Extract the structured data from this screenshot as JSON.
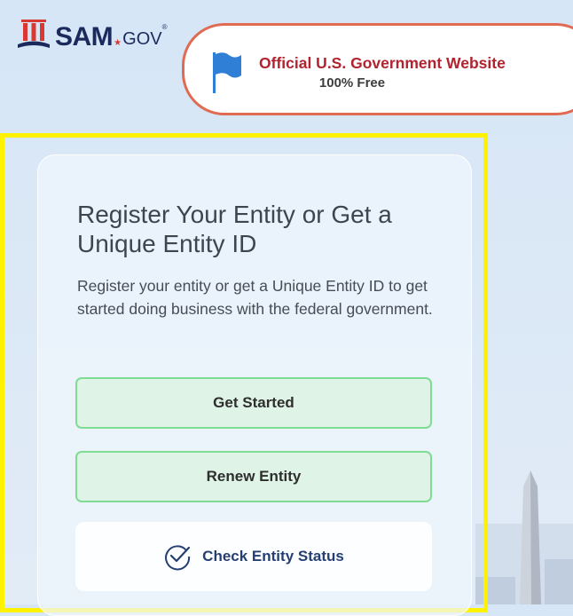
{
  "header": {
    "logo": {
      "name": "SAM",
      "suffix": "GOV",
      "reg": "®"
    },
    "official_banner": {
      "line1": "Official U.S. Government Website",
      "line2": "100% Free"
    }
  },
  "card": {
    "title": "Register Your Entity or Get a Unique Entity ID",
    "description": "Register your entity or get a Unique Entity ID to get started doing business with the federal government.",
    "buttons": {
      "get_started": "Get Started",
      "renew_entity": "Renew Entity",
      "check_status": "Check Entity Status"
    }
  },
  "colors": {
    "banner_text": "#b0232f",
    "banner_border": "#e06a52",
    "button_green_bg": "#dff3e6",
    "button_green_border": "#7fdc95",
    "highlight": "#fff200",
    "navy": "#253f73"
  }
}
